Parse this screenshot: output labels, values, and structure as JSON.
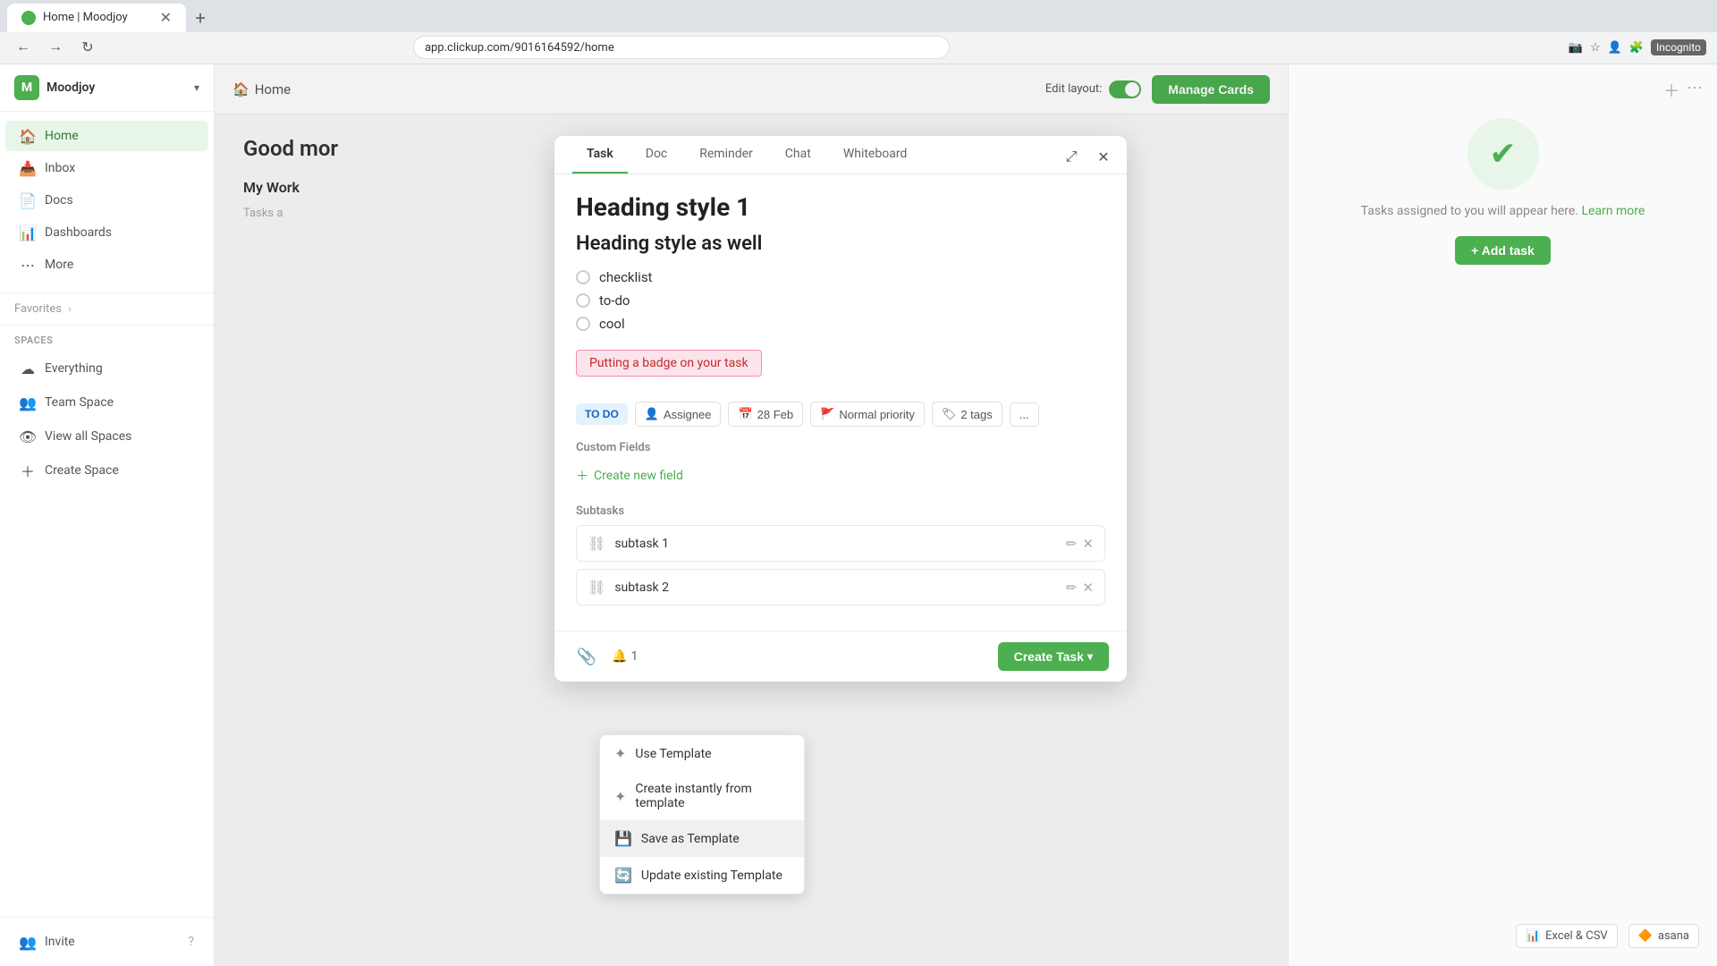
{
  "browser": {
    "tab_label": "Home | Moodjoy",
    "url": "app.clickup.com/9016164592/home",
    "incognito_label": "Incognito"
  },
  "sidebar": {
    "workspace_initial": "M",
    "workspace_name": "Moodjoy",
    "nav_items": [
      {
        "id": "home",
        "label": "Home",
        "icon": "🏠",
        "active": true
      },
      {
        "id": "inbox",
        "label": "Inbox",
        "icon": "📥",
        "active": false
      },
      {
        "id": "docs",
        "label": "Docs",
        "icon": "📄",
        "active": false
      },
      {
        "id": "dashboards",
        "label": "Dashboards",
        "icon": "📊",
        "active": false
      },
      {
        "id": "more",
        "label": "More",
        "icon": "•••",
        "active": false
      }
    ],
    "favorites_label": "Favorites",
    "spaces_label": "Spaces",
    "spaces": [
      {
        "id": "everything",
        "label": "Everything",
        "icon": "☁"
      },
      {
        "id": "team-space",
        "label": "Team Space",
        "icon": "👥"
      },
      {
        "id": "view-all",
        "label": "View all Spaces",
        "icon": "👁"
      },
      {
        "id": "create",
        "label": "Create Space",
        "icon": "+"
      }
    ],
    "invite_label": "Invite"
  },
  "header": {
    "breadcrumb": "Home",
    "edit_layout_label": "Edit layout:",
    "manage_cards_label": "Manage Cards"
  },
  "page": {
    "greeting": "Good mor",
    "section_title": "My Work",
    "tasks_note": "Tasks a"
  },
  "modal": {
    "tabs": [
      {
        "id": "task",
        "label": "Task",
        "active": true
      },
      {
        "id": "doc",
        "label": "Doc",
        "active": false
      },
      {
        "id": "reminder",
        "label": "Reminder",
        "active": false
      },
      {
        "id": "chat",
        "label": "Chat",
        "active": false
      },
      {
        "id": "whiteboard",
        "label": "Whiteboard",
        "active": false
      }
    ],
    "heading1": "Heading style 1",
    "heading2": "Heading style as well",
    "checklist": [
      {
        "label": "checklist"
      },
      {
        "label": "to-do"
      },
      {
        "label": "cool"
      }
    ],
    "badge_label": "Putting a badge on your task",
    "toolbar": {
      "status": "TO DO",
      "assignee": "Assignee",
      "date": "28 Feb",
      "priority": "Normal priority",
      "tags": "2 tags",
      "more": "..."
    },
    "custom_fields_label": "Custom Fields",
    "create_field_label": "+ Create new field",
    "subtasks_label": "Subtasks",
    "subtasks": [
      {
        "label": "subtask 1"
      },
      {
        "label": "subtask 2"
      }
    ],
    "footer": {
      "notification_label": "1",
      "create_task_label": "Create Task"
    }
  },
  "context_menu": {
    "items": [
      {
        "id": "use-template",
        "label": "Use Template",
        "icon": "✦"
      },
      {
        "id": "create-instantly",
        "label": "Create instantly from template",
        "icon": "✦"
      },
      {
        "id": "save-as-template",
        "label": "Save as Template",
        "icon": "💾",
        "highlighted": true
      },
      {
        "id": "update-template",
        "label": "Update existing Template",
        "icon": "🔄"
      }
    ]
  },
  "right_panel": {
    "empty_text": "Tasks assigned to you will appear here.",
    "learn_more_label": "Learn more",
    "add_task_label": "+ Add task"
  },
  "import_options": [
    {
      "label": "Excel & CSV",
      "icon": "📊"
    },
    {
      "label": "asana",
      "icon": "🔶"
    }
  ]
}
